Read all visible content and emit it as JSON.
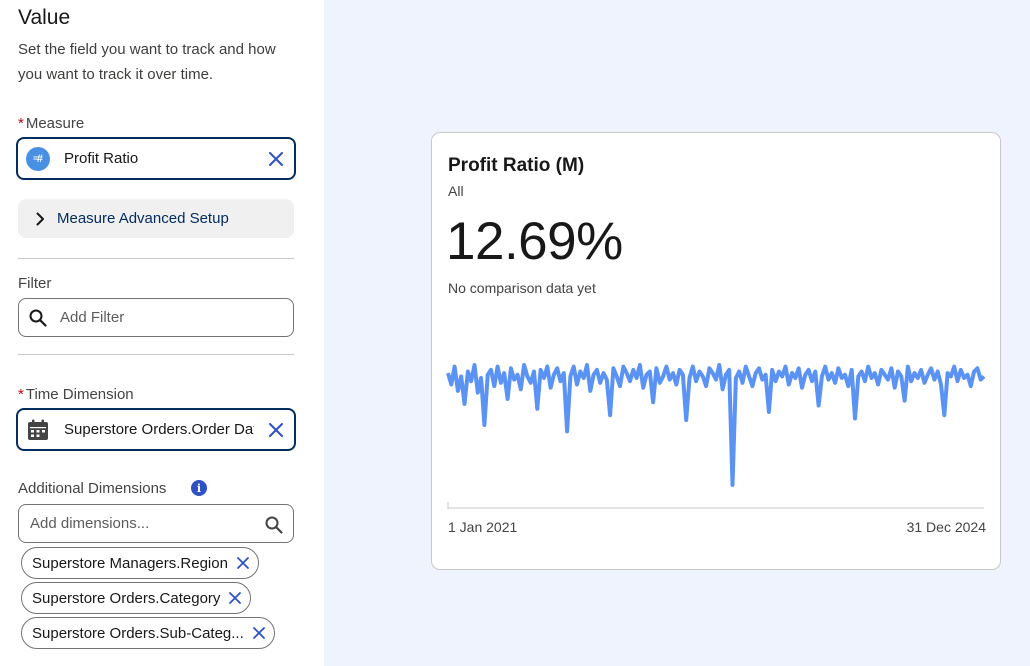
{
  "panel": {
    "title": "Value",
    "description": "Set the field you want to track and how you want to track it over time.",
    "measure": {
      "label": "Measure",
      "required_mark": "*",
      "value": "Profit Ratio",
      "icon": "number-field-icon",
      "icon_text": "#"
    },
    "advanced_setup": {
      "label": "Measure Advanced Setup"
    },
    "filter": {
      "label": "Filter",
      "placeholder": "Add Filter"
    },
    "time_dimension": {
      "label": "Time Dimension",
      "required_mark": "*",
      "value": "Superstore Orders.Order Date"
    },
    "additional_dimensions": {
      "label": "Additional Dimensions",
      "info_icon_text": "i",
      "placeholder": "Add dimensions...",
      "chips": [
        {
          "label": "Superstore Managers.Region"
        },
        {
          "label": "Superstore Orders.Category"
        },
        {
          "label": "Superstore Orders.Sub-Categ..."
        }
      ]
    }
  },
  "card": {
    "title": "Profit Ratio (M)",
    "subtitle": "All",
    "value": "12.69%",
    "comparison_note": "No comparison data yet"
  },
  "colors": {
    "accent": "#032d60",
    "series": "#5b93f5",
    "required": "#ba0517",
    "background": "#eef3fd"
  },
  "chart_data": {
    "type": "line",
    "x_start_label": "1 Jan 2021",
    "x_end_label": "31 Dec 2024",
    "y_unit": "%",
    "ylim": [
      -60,
      40
    ],
    "series": [
      {
        "values": [
          14,
          7,
          18,
          3,
          12,
          -5,
          15,
          9,
          19,
          2,
          11,
          -18,
          13,
          16,
          6,
          18,
          8,
          14,
          -2,
          17,
          10,
          13,
          4,
          19,
          12,
          8,
          15,
          -8,
          16,
          11,
          18,
          5,
          13,
          17,
          9,
          14,
          -22,
          12,
          18,
          7,
          15,
          11,
          19,
          3,
          13,
          16,
          8,
          14,
          10,
          -12,
          17,
          12,
          6,
          18,
          14,
          9,
          16,
          11,
          19,
          5,
          13,
          15,
          -4,
          17,
          8,
          12,
          18,
          10,
          14,
          7,
          16,
          13,
          -15,
          11,
          18,
          9,
          15,
          12,
          6,
          17,
          14,
          10,
          19,
          4,
          13,
          16,
          -55,
          11,
          15,
          8,
          18,
          12,
          6,
          14,
          17,
          10,
          13,
          -10,
          16,
          9,
          15,
          12,
          18,
          7,
          14,
          11,
          17,
          5,
          13,
          16,
          9,
          15,
          -6,
          12,
          18,
          10,
          14,
          8,
          17,
          11,
          13,
          6,
          16,
          -14,
          12,
          15,
          9,
          18,
          11,
          14,
          7,
          16,
          13,
          10,
          17,
          5,
          15,
          12,
          -3,
          18,
          9,
          14,
          11,
          16,
          8,
          13,
          17,
          10,
          15,
          7,
          -12,
          14,
          12,
          18,
          9,
          16,
          11,
          13,
          6,
          15,
          17,
          10,
          12
        ]
      }
    ]
  }
}
